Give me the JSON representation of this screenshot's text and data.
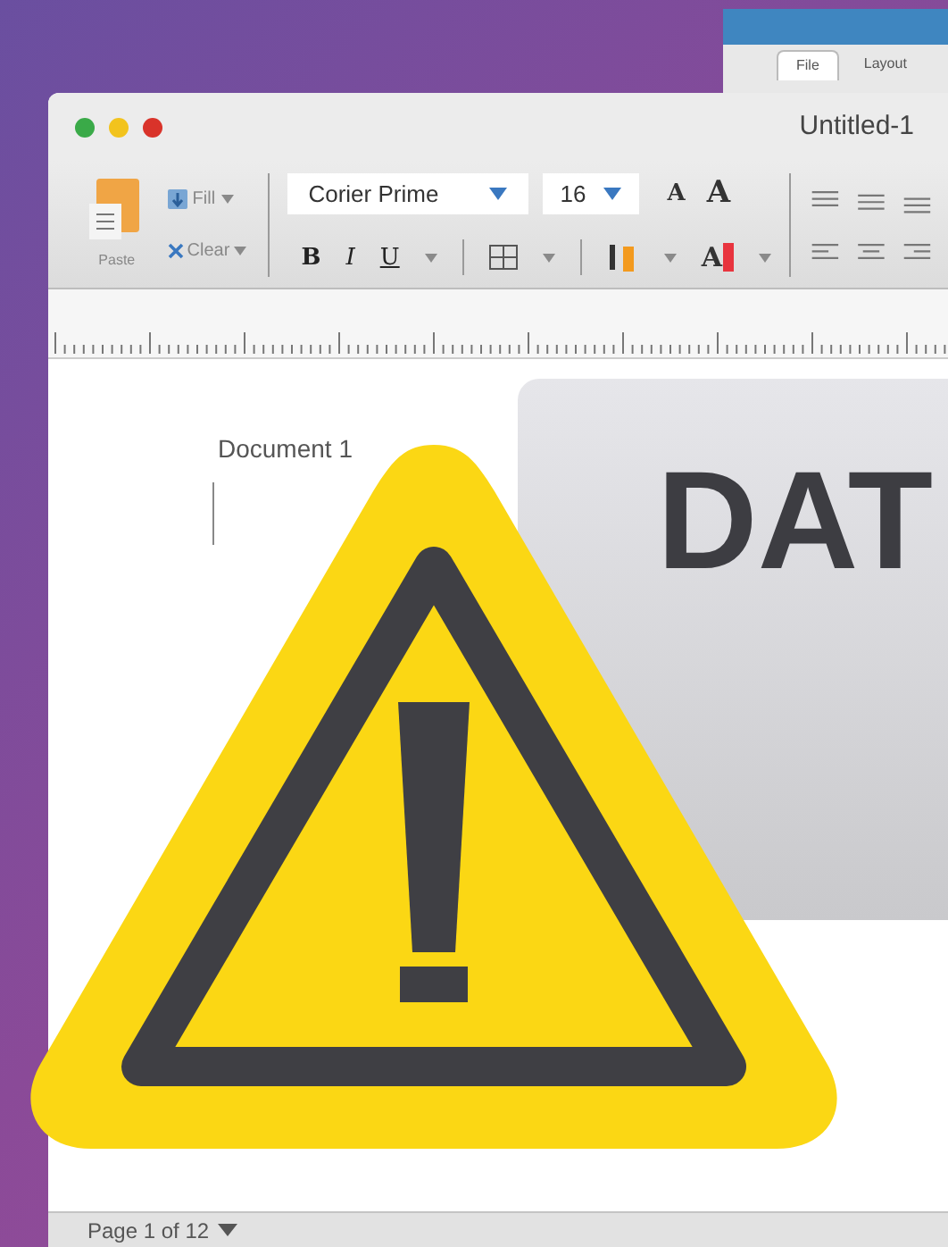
{
  "back_window": {
    "tabs": [
      {
        "label": "File",
        "selected": true
      },
      {
        "label": "Layout",
        "selected": false
      }
    ]
  },
  "window": {
    "title": "Untitled-1"
  },
  "toolbar": {
    "paste": "Paste",
    "fill": "Fill",
    "clear": "Clear",
    "font": "Corier Prime",
    "size": "16",
    "grow_font": "A",
    "shrink_font": "A",
    "format_buttons": [
      "B",
      "I",
      "U"
    ],
    "font_color": "A"
  },
  "document": {
    "heading": "Document 1"
  },
  "graphic": {
    "text": "DAT"
  },
  "status_bar": {
    "page": "Page 1 of 12"
  }
}
